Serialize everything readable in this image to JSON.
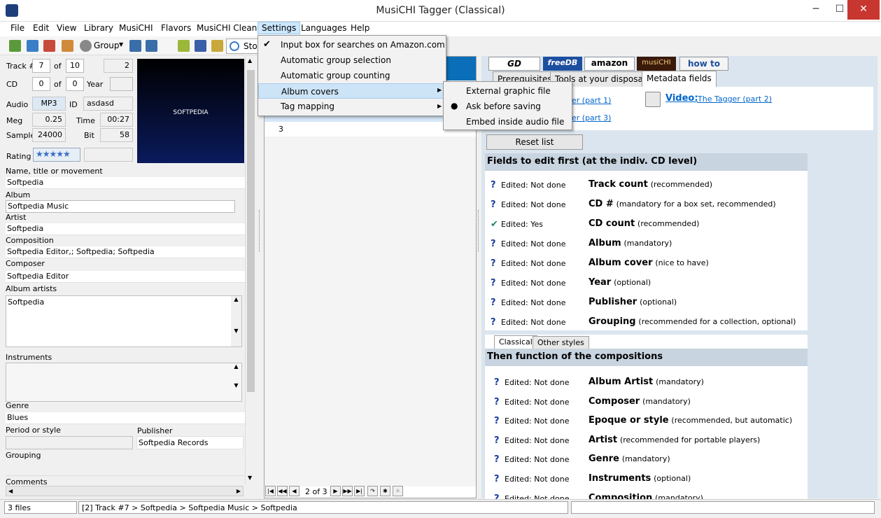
{
  "window": {
    "title": "MusiCHI Tagger (Classical)"
  },
  "menu": [
    "File",
    "Edit",
    "View",
    "Library",
    "MusiCHI",
    "Flavors",
    "MusiCHI Clean",
    "Settings",
    "Languages",
    "Help"
  ],
  "toolbar": {
    "group_label": "Group",
    "stop_label": "Stop"
  },
  "track": {
    "track_label": "Track #",
    "track": "7",
    "of_label": "of",
    "total": "10",
    "extra": "2",
    "cd_label": "CD",
    "cd": "0",
    "cd_of": "0",
    "year_label": "Year",
    "audio_label": "Audio",
    "format": "MP3",
    "id_label": "ID",
    "id": "asdasd",
    "meg_label": "Meg",
    "meg": "0.25",
    "time_label": "Time",
    "time": "00:27",
    "sample_label": "Sample",
    "sample": "24000",
    "bit_label": "Bit",
    "bit": "58",
    "rating_label": "Rating",
    "cover_text": "SOFTPEDIA"
  },
  "fields": {
    "name_label": "Name, title or movement",
    "name": "Softpedia",
    "album_label": "Album",
    "album": "Softpedia Music",
    "artist_label": "Artist",
    "artist": "Softpedia",
    "composition_label": "Composition",
    "composition": "Softpedia Editor,; Softpedia; Softpedia",
    "composer_label": "Composer",
    "composer": "Softpedia Editor",
    "album_artists_label": "Album artists",
    "album_artists": "Softpedia",
    "instruments_label": "Instruments",
    "genre_label": "Genre",
    "genre": "Blues",
    "period_label": "Period or style",
    "publisher_label": "Publisher",
    "publisher": "Softpedia Records",
    "grouping_label": "Grouping",
    "comments_label": "Comments"
  },
  "middle": {
    "row3": "3",
    "pager": "2 of 3"
  },
  "settings_menu": [
    "Input box for searches on Amazon.com",
    "Automatic group selection",
    "Automatic group counting",
    "Album covers",
    "Tag mapping"
  ],
  "album_covers_menu": [
    "External graphic file",
    "Ask before saving",
    "Embed inside audio file"
  ],
  "right": {
    "logo_gd": "GD",
    "logo_freedb": "freeDB",
    "logo_amazon": "amazon",
    "logo_musichi": "musiCHI",
    "logo_howto": "how to",
    "tabs": [
      "Prerequisites",
      "Tools at your disposal",
      "Metadata fields"
    ],
    "link1": "er (part 1)",
    "link2": "er (part 3)",
    "video_label": "Video:",
    "video_link": "The Tagger (part 2)",
    "reset": "Reset list",
    "section1_title": "Fields to edit first (at the indiv. CD level)",
    "section2_title": "Then function of the compositions",
    "subtabs": [
      "Classical",
      "Other styles"
    ]
  },
  "fields_first": [
    {
      "status": "Edited: Not done",
      "name": "Track count",
      "note": "(recommended)"
    },
    {
      "status": "Edited: Not done",
      "name": "CD #",
      "note": "(mandatory for a box set, recommended)"
    },
    {
      "status": "Edited: Yes",
      "name": "CD count",
      "note": "(recommended)"
    },
    {
      "status": "Edited: Not done",
      "name": "Album",
      "note": "(mandatory)"
    },
    {
      "status": "Edited: Not done",
      "name": "Album cover",
      "note": "(nice to have)"
    },
    {
      "status": "Edited: Not done",
      "name": "Year",
      "note": "(optional)"
    },
    {
      "status": "Edited: Not done",
      "name": "Publisher",
      "note": "(optional)"
    },
    {
      "status": "Edited: Not done",
      "name": "Grouping",
      "note": "(recommended for a collection, optional)"
    }
  ],
  "fields_second": [
    {
      "status": "Edited: Not done",
      "name": "Album Artist",
      "note": "(mandatory)"
    },
    {
      "status": "Edited: Not done",
      "name": "Composer",
      "note": "(mandatory)"
    },
    {
      "status": "Edited: Not done",
      "name": "Epoque or style",
      "note": "(recommended, but automatic)"
    },
    {
      "status": "Edited: Not done",
      "name": "Artist",
      "note": "(recommended for portable players)"
    },
    {
      "status": "Edited: Not done",
      "name": "Genre",
      "note": "(mandatory)"
    },
    {
      "status": "Edited: Not done",
      "name": "Instruments",
      "note": "(optional)"
    },
    {
      "status": "Edited: Not done",
      "name": "Composition",
      "note": "(mandatory)"
    }
  ],
  "status": {
    "files": "3 files",
    "path": "[2] Track #7 > Softpedia > Softpedia Music > Softpedia"
  },
  "colors": {
    "accent": "#0066cc",
    "cover_bg": "#0a1a5c"
  }
}
